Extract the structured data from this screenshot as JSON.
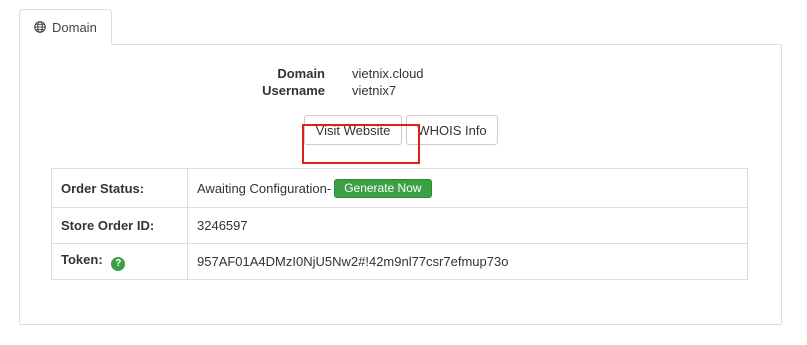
{
  "tab": {
    "label": "Domain",
    "icon": "globe-icon"
  },
  "domain_info": {
    "domain_label": "Domain",
    "domain_value": "vietnix.cloud",
    "username_label": "Username",
    "username_value": "vietnix7"
  },
  "actions": {
    "visit_website": "Visit Website",
    "whois_info": "WHOIS Info"
  },
  "details": {
    "order_status_label": "Order Status:",
    "order_status_value": "Awaiting Configuration",
    "separator": "-",
    "generate_now": "Generate Now",
    "store_order_id_label": "Store Order ID:",
    "store_order_id_value": "3246597",
    "token_label": "Token:",
    "token_value": "957AF01A4DMzI0NjU5Nw2#!42m9nl77csr7efmup73o",
    "help_icon": "question-circle-icon"
  },
  "colors": {
    "accent_green": "#3aa043",
    "highlight_red": "#d9231d",
    "border": "#dddddd"
  }
}
